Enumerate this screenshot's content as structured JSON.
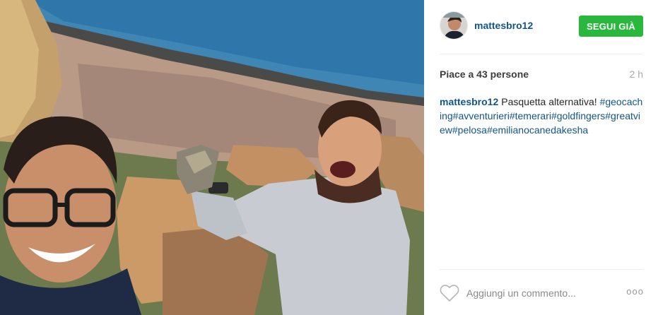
{
  "post": {
    "author": "mattesbro12",
    "follow_label": "SEGUI GIÀ",
    "likes_text": "Piace a 43 persone",
    "time_ago": "2 h",
    "caption": {
      "user": "mattesbro12",
      "text": "Pasquetta alternativa!",
      "tags": "#geocaching#avventurieri#temerari#goldfingers#greatview#pelosa#emilianocanedakesha"
    },
    "comment_placeholder": "Aggiungi un commento...",
    "more_label": "ooo"
  },
  "icons": {
    "like": "heart-icon",
    "more": "more-options-icon"
  },
  "colors": {
    "link": "#125688",
    "follow_button": "#2ab73e",
    "muted": "#a5a7aa"
  }
}
